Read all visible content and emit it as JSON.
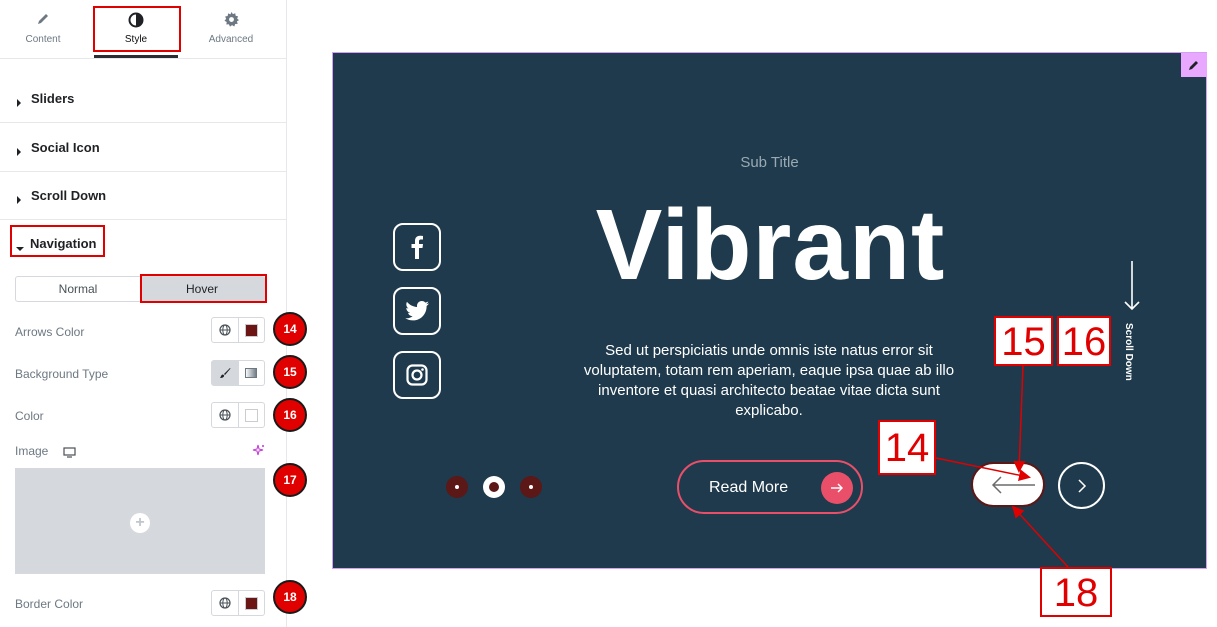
{
  "tabs": [
    {
      "label": "Content",
      "icon": "pencil-icon"
    },
    {
      "label": "Style",
      "icon": "half-circle-icon"
    },
    {
      "label": "Advanced",
      "icon": "gear-icon"
    }
  ],
  "sections": [
    {
      "title": "Sliders"
    },
    {
      "title": "Social Icon"
    },
    {
      "title": "Scroll Down"
    }
  ],
  "navigation": {
    "title": "Navigation",
    "toggle": {
      "normal": "Normal",
      "hover": "Hover"
    },
    "controls": {
      "arrows_color": "Arrows Color",
      "background_type": "Background Type",
      "color": "Color",
      "image": "Image",
      "border_color": "Border Color"
    },
    "swatches": {
      "arrows_color": "#6b1515",
      "color": "#ffffff",
      "border_color": "#6b1515"
    }
  },
  "badges": [
    "14",
    "15",
    "16",
    "17",
    "18"
  ],
  "preview": {
    "subtitle": "Sub Title",
    "title": "Vibrant",
    "text": "Sed ut perspiciatis unde omnis iste natus error sit voluptatem, totam rem aperiam, eaque ipsa quae ab illo inventore et quasi architecto beatae vitae dicta sunt explicabo.",
    "read_more": "Read More",
    "scroll_down": "Scroll Down",
    "background": "#1e3a4c",
    "accent": "#ea4f6a",
    "dot_color": "#5c1717"
  },
  "annotations": [
    "14",
    "15",
    "16",
    "18"
  ]
}
